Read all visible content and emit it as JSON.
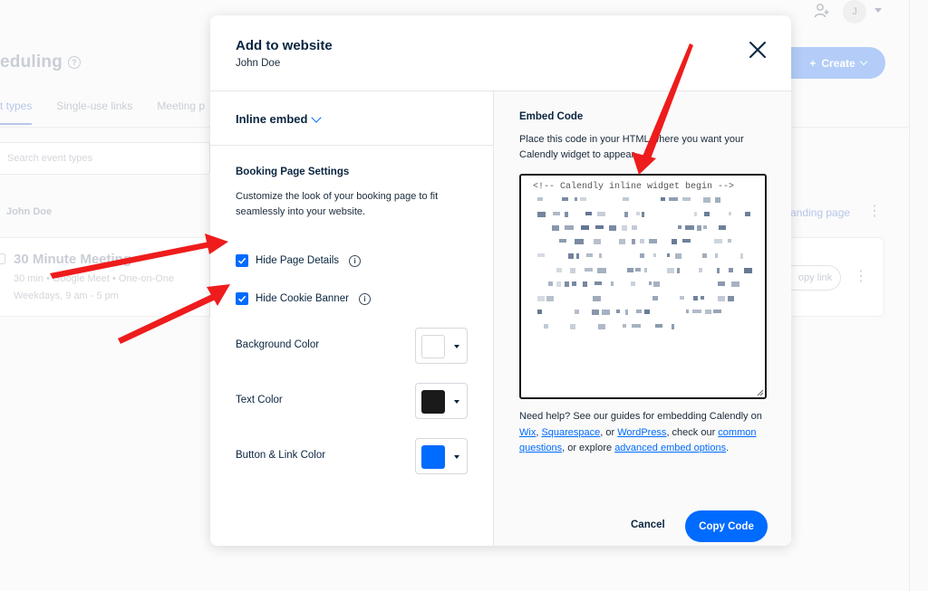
{
  "background": {
    "page_title": "eduling",
    "tabs": [
      "t types",
      "Single-use links",
      "Meeting p"
    ],
    "search_placeholder": "Search event types",
    "user_name": "John Doe",
    "event": {
      "title": "30 Minute Meeting",
      "meta": "30 min • Google Meet • One-on-One",
      "hours": "Weekdays, 9 am - 5 pm"
    },
    "landing_page": "anding page",
    "copy_link": "opy link",
    "create_label": "Create",
    "avatar_initial": "J"
  },
  "modal": {
    "title": "Add to website",
    "subtitle": "John Doe",
    "embed_type": "Inline embed",
    "booking_settings": {
      "heading": "Booking Page Settings",
      "description": "Customize the look of your booking page to fit seamlessly into your website.",
      "options": [
        {
          "label": "Hide Page Details",
          "checked": true
        },
        {
          "label": "Hide Cookie Banner",
          "checked": true
        }
      ],
      "colors": [
        {
          "label": "Background Color",
          "value": "#ffffff"
        },
        {
          "label": "Text Color",
          "value": "#1a1a1a"
        },
        {
          "label": "Button & Link Color",
          "value": "#006bff"
        }
      ]
    },
    "embed_code": {
      "heading": "Embed Code",
      "description": "Place this code in your HTML where you want your Calendly widget to appear.",
      "code_first_line": "<!-- Calendly inline widget begin -->"
    },
    "help": {
      "t1": "Need help? See our guides for embedding Calendly on ",
      "wix": "Wix",
      "sep1": ", ",
      "squarespace": "Squarespace",
      "sep2": ", or ",
      "wordpress": "WordPress",
      "t2": ", check our ",
      "common_questions": "common questions",
      "t3": ", or explore ",
      "advanced": "advanced embed options",
      "t4": "."
    },
    "cancel_label": "Cancel",
    "copy_label": "Copy Code"
  },
  "colors": {
    "primary": "#006bff",
    "annotation_arrow": "#ee1c1c"
  }
}
